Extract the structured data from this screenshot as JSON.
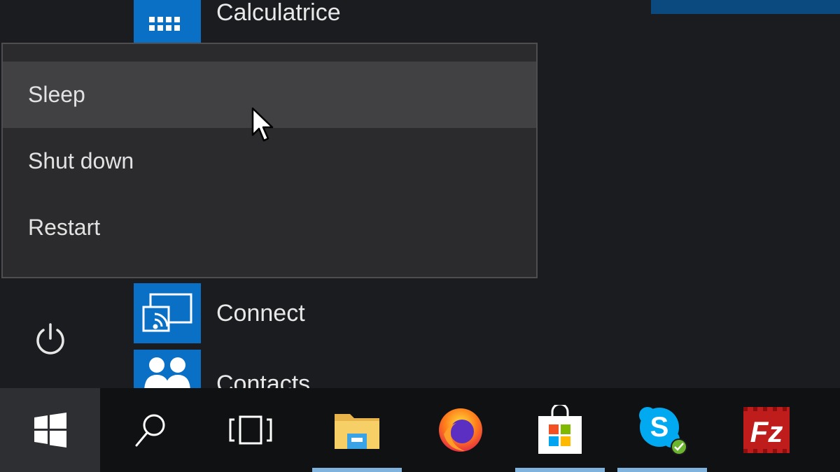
{
  "apps": {
    "calculator": {
      "label": "Calculatrice",
      "icon": "calculator-icon"
    },
    "connect": {
      "label": "Connect",
      "icon": "connect-cast-icon"
    },
    "contacts": {
      "label": "Contacts",
      "icon": "contacts-people-icon"
    }
  },
  "power_menu": {
    "items": [
      {
        "label": "Sleep",
        "highlighted": true
      },
      {
        "label": "Shut down",
        "highlighted": false
      },
      {
        "label": "Restart",
        "highlighted": false
      }
    ]
  },
  "taskbar": {
    "items": [
      {
        "name": "start",
        "icon": "windows-logo-icon"
      },
      {
        "name": "search",
        "icon": "search-icon"
      },
      {
        "name": "task-view",
        "icon": "task-view-icon"
      },
      {
        "name": "file-explorer",
        "icon": "folder-icon",
        "running": true
      },
      {
        "name": "firefox",
        "icon": "firefox-icon"
      },
      {
        "name": "store",
        "icon": "store-bag-icon",
        "running": true
      },
      {
        "name": "skype",
        "icon": "skype-icon",
        "running": true
      },
      {
        "name": "filezilla",
        "icon": "filezilla-icon"
      }
    ]
  },
  "colors": {
    "accent_tile": "#0a70c6",
    "menu_bg": "#2b2b2d",
    "menu_hover": "#414143",
    "taskbar_bg": "#101113",
    "running_indicator": "#7fb2dc"
  }
}
